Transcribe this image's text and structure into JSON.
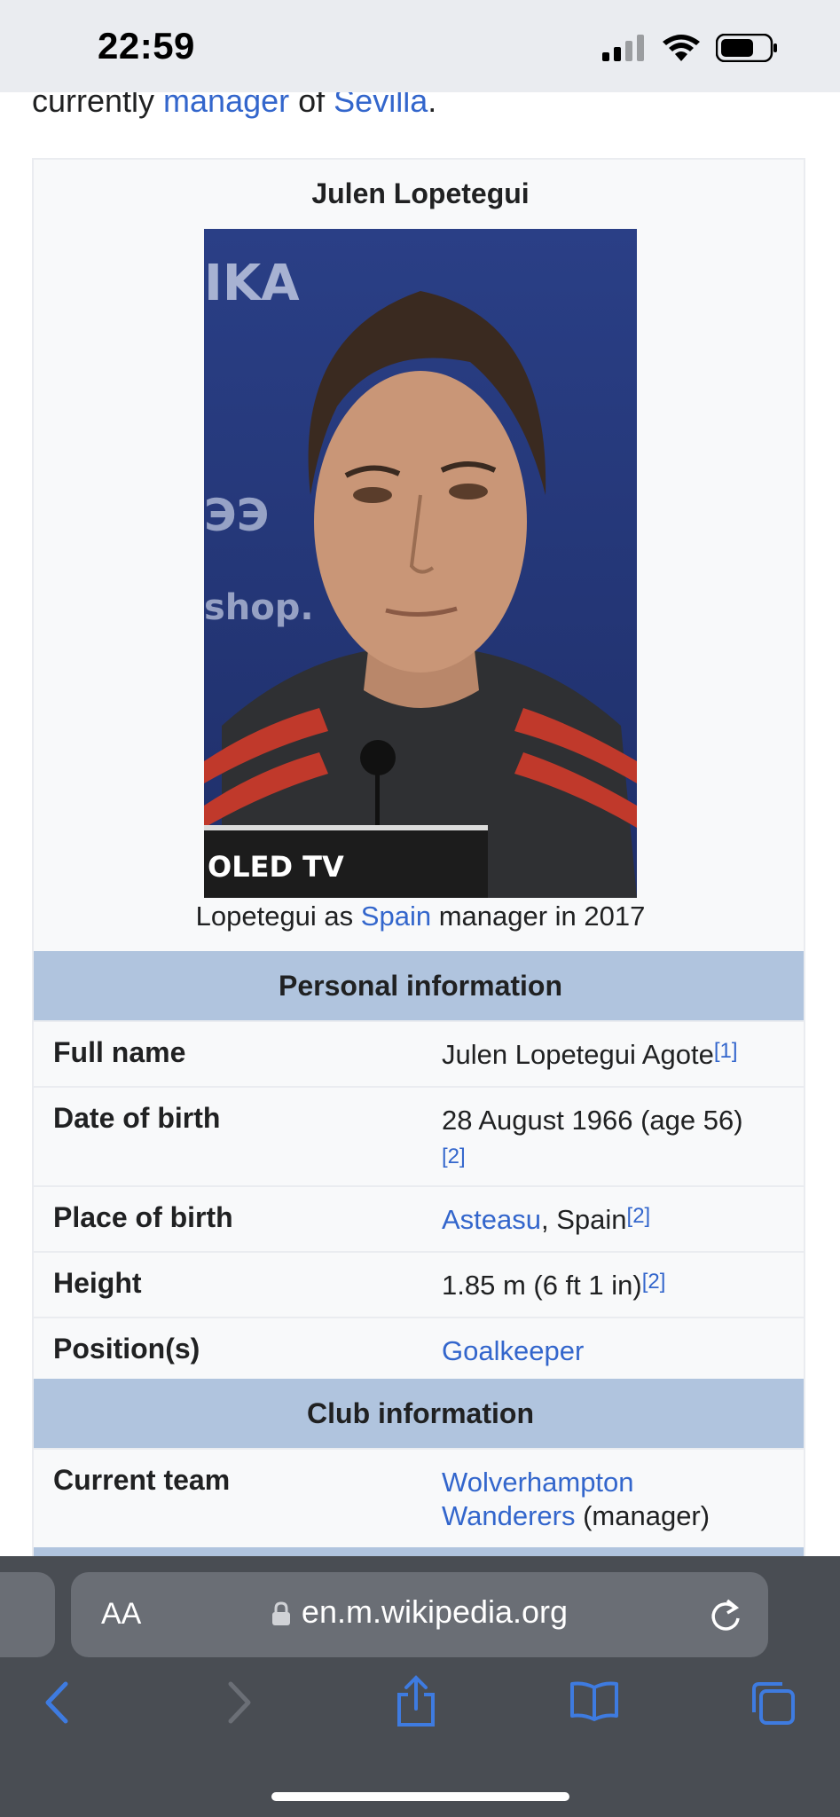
{
  "status": {
    "time": "22:59"
  },
  "lead": {
    "prefix": "currently ",
    "link1": "manager",
    "middle": " of ",
    "link2": "Sevilla",
    "suffix": "."
  },
  "infobox": {
    "title": "Julen Lopetegui",
    "photo_text": "OLED TV",
    "caption": {
      "prefix": "Lopetegui as ",
      "link": "Spain",
      "suffix": " manager in 2017"
    },
    "personal_header": "Personal information",
    "rows": [
      {
        "label": "Full name",
        "value": "Julen Lopetegui Agote",
        "ref": "[1]"
      },
      {
        "label": "Date of birth",
        "value": "28 August 1966 (age 56)",
        "ref": "[2]"
      },
      {
        "label": "Place of birth",
        "link": "Asteasu",
        "value": ", Spain",
        "ref": "[2]"
      },
      {
        "label": "Height",
        "value": "1.85 m (6 ft 1 in)",
        "ref": "[2]"
      },
      {
        "label": "Position(s)",
        "link": "Goalkeeper"
      }
    ],
    "club_header": "Club information",
    "current_team": {
      "label": "Current team",
      "link_line1": "Wolverhampton",
      "link_line2": "Wanderers",
      "suffix": " (manager)"
    }
  },
  "browser": {
    "aa_label": "AA",
    "url": "en.m.wikipedia.org"
  },
  "colors": {
    "link": "#3366cc",
    "section_header": "#b0c4de",
    "chrome": "#494d53",
    "toolbar_icon": "#3e7be0"
  }
}
